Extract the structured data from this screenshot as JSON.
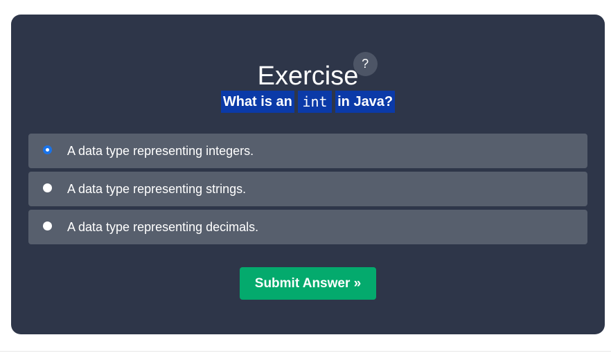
{
  "exercise": {
    "title": "Exercise",
    "help_icon": "?",
    "question": {
      "prefix": "What is an",
      "code": "int",
      "suffix": "in Java?"
    },
    "options": [
      {
        "label": "A data type representing integers.",
        "selected": true
      },
      {
        "label": "A data type representing strings.",
        "selected": false
      },
      {
        "label": "A data type representing decimals.",
        "selected": false
      }
    ],
    "submit_label": "Submit Answer »"
  },
  "colors": {
    "card_bg": "#2e3649",
    "option_bg": "#575f6d",
    "question_highlight": "#0b3aa8",
    "submit_bg": "#04aa6d",
    "radio_checked": "#1a73e8"
  }
}
